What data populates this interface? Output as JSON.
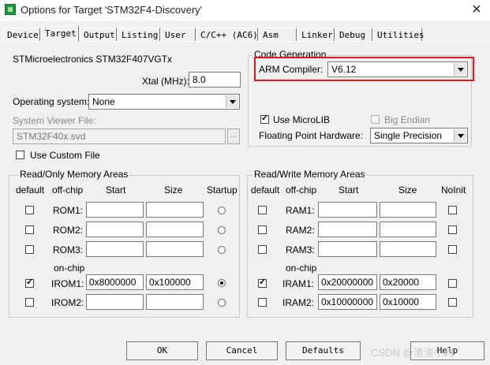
{
  "window": {
    "title": "Options for Target 'STM32F4-Discovery'",
    "close_glyph": "✕"
  },
  "tabs": [
    {
      "label": "Device"
    },
    {
      "label": "Target"
    },
    {
      "label": "Output"
    },
    {
      "label": "Listing"
    },
    {
      "label": "User"
    },
    {
      "label": "C/C++ (AC6)"
    },
    {
      "label": "Asm"
    },
    {
      "label": "Linker"
    },
    {
      "label": "Debug"
    },
    {
      "label": "Utilities"
    }
  ],
  "active_tab": "Target",
  "device": {
    "name": "STMicroelectronics STM32F407VGTx",
    "xtal_label": "Xtal (MHz):",
    "xtal_value": "8.0",
    "os_label": "Operating system:",
    "os_value": "None",
    "svd_label": "System Viewer File:",
    "svd_value": "STM32F40x.svd",
    "browse_label": "...",
    "use_custom_file_label": "Use Custom File",
    "use_custom_file_checked": false
  },
  "code_generation": {
    "title": "Code Generation",
    "compiler_label": "ARM Compiler:",
    "compiler_value": "V6.12",
    "use_microlib_label": "Use MicroLIB",
    "use_microlib_checked": true,
    "big_endian_label": "Big Endian",
    "big_endian_checked": false,
    "fpu_label": "Floating Point Hardware:",
    "fpu_value": "Single Precision",
    "highlight_color": "#e0161f"
  },
  "ro_memory": {
    "title": "Read/Only Memory Areas",
    "headers": {
      "default": "default",
      "offchip": "off-chip",
      "start": "Start",
      "size": "Size",
      "startup": "Startup"
    },
    "onchip_label": "on-chip",
    "rows": [
      {
        "name": "ROM1:",
        "default": false,
        "start": "",
        "size": "",
        "startup": false
      },
      {
        "name": "ROM2:",
        "default": false,
        "start": "",
        "size": "",
        "startup": false
      },
      {
        "name": "ROM3:",
        "default": false,
        "start": "",
        "size": "",
        "startup": false
      },
      {
        "name": "IROM1:",
        "default": true,
        "start": "0x8000000",
        "size": "0x100000",
        "startup": true
      },
      {
        "name": "IROM2:",
        "default": false,
        "start": "",
        "size": "",
        "startup": false
      }
    ]
  },
  "rw_memory": {
    "title": "Read/Write Memory Areas",
    "headers": {
      "default": "default",
      "offchip": "off-chip",
      "start": "Start",
      "size": "Size",
      "noinit": "NoInit"
    },
    "onchip_label": "on-chip",
    "rows": [
      {
        "name": "RAM1:",
        "default": false,
        "start": "",
        "size": "",
        "noinit": false
      },
      {
        "name": "RAM2:",
        "default": false,
        "start": "",
        "size": "",
        "noinit": false
      },
      {
        "name": "RAM3:",
        "default": false,
        "start": "",
        "size": "",
        "noinit": false
      },
      {
        "name": "IRAM1:",
        "default": true,
        "start": "0x20000000",
        "size": "0x20000",
        "noinit": false
      },
      {
        "name": "IRAM2:",
        "default": false,
        "start": "0x10000000",
        "size": "0x10000",
        "noinit": false
      }
    ]
  },
  "buttons": {
    "ok": "OK",
    "cancel": "Cancel",
    "defaults": "Defaults",
    "help": "Help"
  },
  "watermark": "CSDN @渣渣小码"
}
